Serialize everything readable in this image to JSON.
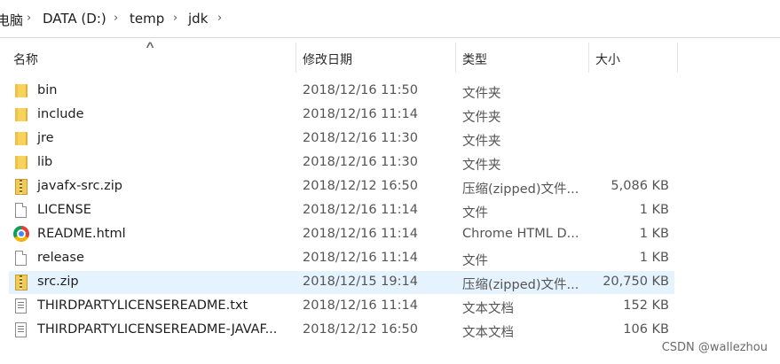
{
  "breadcrumb": {
    "items": [
      "电脑",
      "DATA (D:)",
      "temp",
      "jdk"
    ]
  },
  "columns": {
    "name": "名称",
    "date": "修改日期",
    "type": "类型",
    "size": "大小"
  },
  "files": [
    {
      "name": "bin",
      "date": "2018/12/16 11:50",
      "type": "文件夹",
      "size": "",
      "icon": "folder-icon"
    },
    {
      "name": "include",
      "date": "2018/12/16 11:14",
      "type": "文件夹",
      "size": "",
      "icon": "folder-icon"
    },
    {
      "name": "jre",
      "date": "2018/12/16 11:30",
      "type": "文件夹",
      "size": "",
      "icon": "folder-icon"
    },
    {
      "name": "lib",
      "date": "2018/12/16 11:30",
      "type": "文件夹",
      "size": "",
      "icon": "folder-icon"
    },
    {
      "name": "javafx-src.zip",
      "date": "2018/12/12 16:50",
      "type": "压缩(zipped)文件...",
      "size": "5,086 KB",
      "icon": "zip-icon"
    },
    {
      "name": "LICENSE",
      "date": "2018/12/16 11:14",
      "type": "文件",
      "size": "1 KB",
      "icon": "file-icon"
    },
    {
      "name": "README.html",
      "date": "2018/12/16 11:14",
      "type": "Chrome HTML D...",
      "size": "1 KB",
      "icon": "chrome-icon"
    },
    {
      "name": "release",
      "date": "2018/12/16 11:14",
      "type": "文件",
      "size": "1 KB",
      "icon": "file-icon"
    },
    {
      "name": "src.zip",
      "date": "2018/12/15 19:14",
      "type": "压缩(zipped)文件...",
      "size": "20,750 KB",
      "icon": "zip-icon",
      "selected": true
    },
    {
      "name": "THIRDPARTYLICENSEREADME.txt",
      "date": "2018/12/16 11:14",
      "type": "文本文档",
      "size": "152 KB",
      "icon": "text-file-icon"
    },
    {
      "name": "THIRDPARTYLICENSEREADME-JAVAF...",
      "date": "2018/12/12 16:50",
      "type": "文本文档",
      "size": "106 KB",
      "icon": "text-file-icon"
    }
  ],
  "watermark": "CSDN @wallezhou",
  "colors": {
    "selected_row": "#e5f3ff",
    "folder": "#f7d35c"
  }
}
